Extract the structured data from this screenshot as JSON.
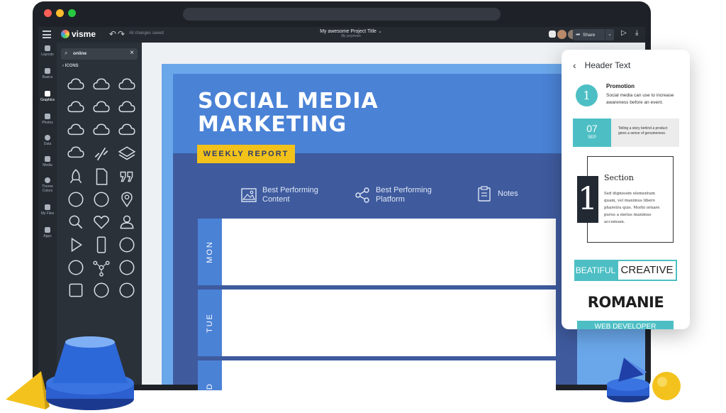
{
  "app": {
    "logo_text": "visme",
    "saved_status": "All changes saved",
    "project_title": "My awesome Project Title",
    "project_author": "By poyman",
    "share_label": "Share"
  },
  "rail": [
    {
      "label": "Layouts"
    },
    {
      "label": "Basics"
    },
    {
      "label": "Graphics"
    },
    {
      "label": "Photos"
    },
    {
      "label": "Data"
    },
    {
      "label": "Media"
    },
    {
      "label": "Theme Colors"
    },
    {
      "label": "My Files"
    },
    {
      "label": "Apps"
    }
  ],
  "panel": {
    "search_value": "online",
    "back_label": "ICONS",
    "icons": [
      "cloud-icon",
      "cloud-upload-icon",
      "cloud-download-icon",
      "cloud-user-icon",
      "cloud-remove-user-icon",
      "cloud-add-user-icon",
      "cloud-x-icon",
      "cloud-minus-icon",
      "cloud-settings-icon",
      "cloud-sync-icon",
      "link-broken-icon",
      "layers-icon",
      "rocket-icon",
      "document-icon",
      "quote-icon",
      "headset-user-icon",
      "support-agent-icon",
      "location-pin-icon",
      "search-icon",
      "heart-icon",
      "user-icon",
      "play-icon",
      "mobile-icon",
      "check-circle-icon",
      "close-circle-icon",
      "network-icon",
      "globe-icon",
      "calendar-icon",
      "play-circle-icon",
      "play-circle-alt-icon"
    ]
  },
  "canvas": {
    "title_line1": "SOCIAL MEDIA",
    "title_line2": "MARKETING",
    "badge": "WEEKLY REPORT",
    "columns": [
      {
        "label_1": "Best Performing",
        "label_2": "Content",
        "icon": "image-icon"
      },
      {
        "label_1": "Best Performing",
        "label_2": "Platform",
        "icon": "share-icon"
      },
      {
        "label_1": "Notes",
        "label_2": "",
        "icon": "clipboard-icon"
      }
    ],
    "rows": [
      {
        "day": "MON"
      },
      {
        "day": "TUE"
      },
      {
        "day": "WED"
      }
    ]
  },
  "phone": {
    "header": "Header Text",
    "promo_number": "1",
    "promo_title": "Promotion",
    "promo_desc": "Social media can use to increase awareness before an event.",
    "date_day": "07",
    "date_month": "SEP",
    "date_text": "Telling a story behind a product gives a sense of genuineness.",
    "section_number": "1",
    "section_title": "Section",
    "section_text": "Sed dignissim elementum quam, vel maximus libero pharetra quis. Morbi ornare purus a metus maximus accumsan.",
    "beautiful": "BEATIFUL",
    "creative": "CREATIVE",
    "romanie": "ROMANIE",
    "webdev": "WEB DEVELOPER"
  },
  "colors": {
    "accent_blue": "#4a82d6",
    "navy": "#3f5b9e",
    "yellow": "#f2c21b",
    "teal": "#4dbfc4"
  }
}
